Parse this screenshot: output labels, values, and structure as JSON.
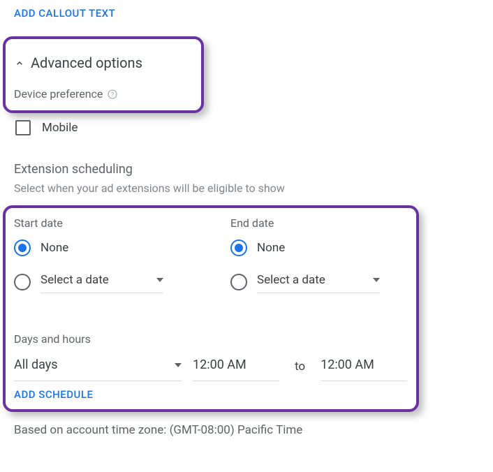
{
  "add_callout_label": "ADD CALLOUT TEXT",
  "advanced_options": {
    "title": "Advanced options",
    "device_pref_label": "Device preference",
    "mobile_label": "Mobile"
  },
  "ext_scheduling": {
    "title": "Extension scheduling",
    "subtitle": "Select when your ad extensions will be eligible to show"
  },
  "dates": {
    "start_label": "Start date",
    "end_label": "End date",
    "none_label": "None",
    "select_date_label": "Select a date"
  },
  "days_hours": {
    "title": "Days and hours",
    "days_value": "All days",
    "time_from": "12:00 AM",
    "to_label": "to",
    "time_to": "12:00 AM"
  },
  "add_schedule_label": "ADD SCHEDULE",
  "tz_note": "Based on account time zone: (GMT-08:00) Pacific Time"
}
